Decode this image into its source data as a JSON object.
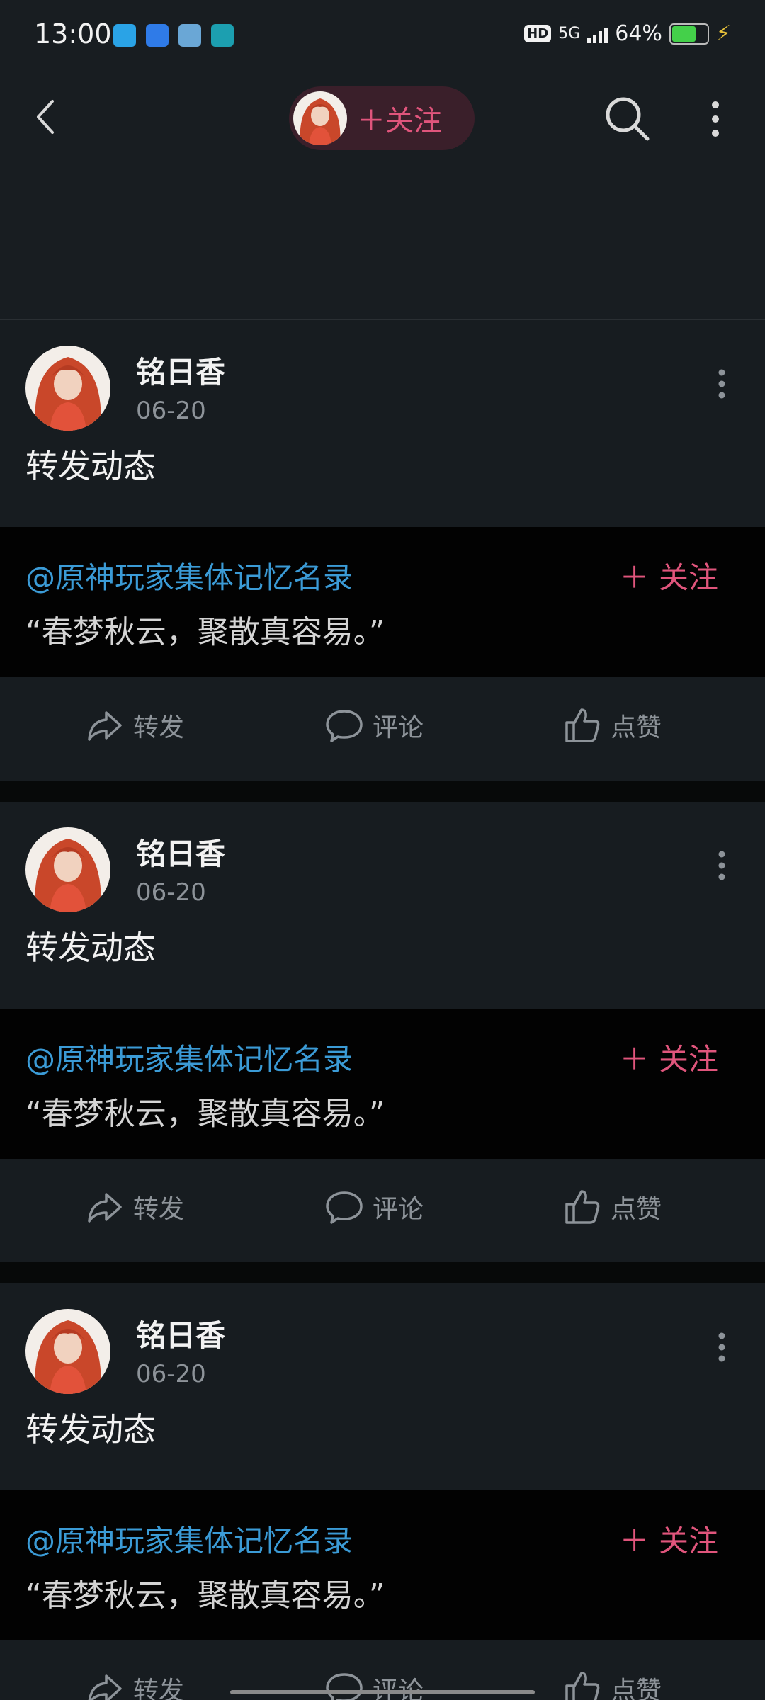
{
  "status_bar": {
    "time": "13:00",
    "network": "5G",
    "battery": "64%",
    "hd": "HD",
    "app_icons": [
      "telegram-icon",
      "translate-icon",
      "news-icon",
      "vpn-icon"
    ],
    "battery_level": 0.64,
    "battery_color": "#44d04a"
  },
  "header": {
    "follow_label": "＋关注",
    "icons": [
      "back-icon",
      "search-icon",
      "more-vertical-icon"
    ],
    "pill_bg": "#3a1f2a",
    "accent": "#e0557c"
  },
  "posts": [
    {
      "author": "铭日香",
      "date": "06-20",
      "text": "转发动态",
      "quote_user": "@原神玩家集体记忆名录",
      "quote_follow": "＋ 关注",
      "quote_text": "“春梦秋云，聚散真容易。”",
      "actions": [
        "转发",
        "评论",
        "点赞"
      ]
    },
    {
      "author": "铭日香",
      "date": "06-20",
      "text": "转发动态",
      "quote_user": "@原神玩家集体记忆名录",
      "quote_follow": "＋ 关注",
      "quote_text": "“春梦秋云，聚散真容易。”",
      "actions": [
        "转发",
        "评论",
        "点赞"
      ]
    },
    {
      "author": "铭日香",
      "date": "06-20",
      "text": "转发动态",
      "quote_user": "@原神玩家集体记忆名录",
      "quote_follow": "＋ 关注",
      "quote_text": "“春梦秋云，聚散真容易。”",
      "actions": [
        "转发",
        "评论",
        "点赞"
      ]
    }
  ],
  "colors": {
    "background": "#0f1316",
    "card": "#171c20",
    "quote_bg": "#020202",
    "link": "#3b9bd6",
    "muted": "#8d9399"
  }
}
